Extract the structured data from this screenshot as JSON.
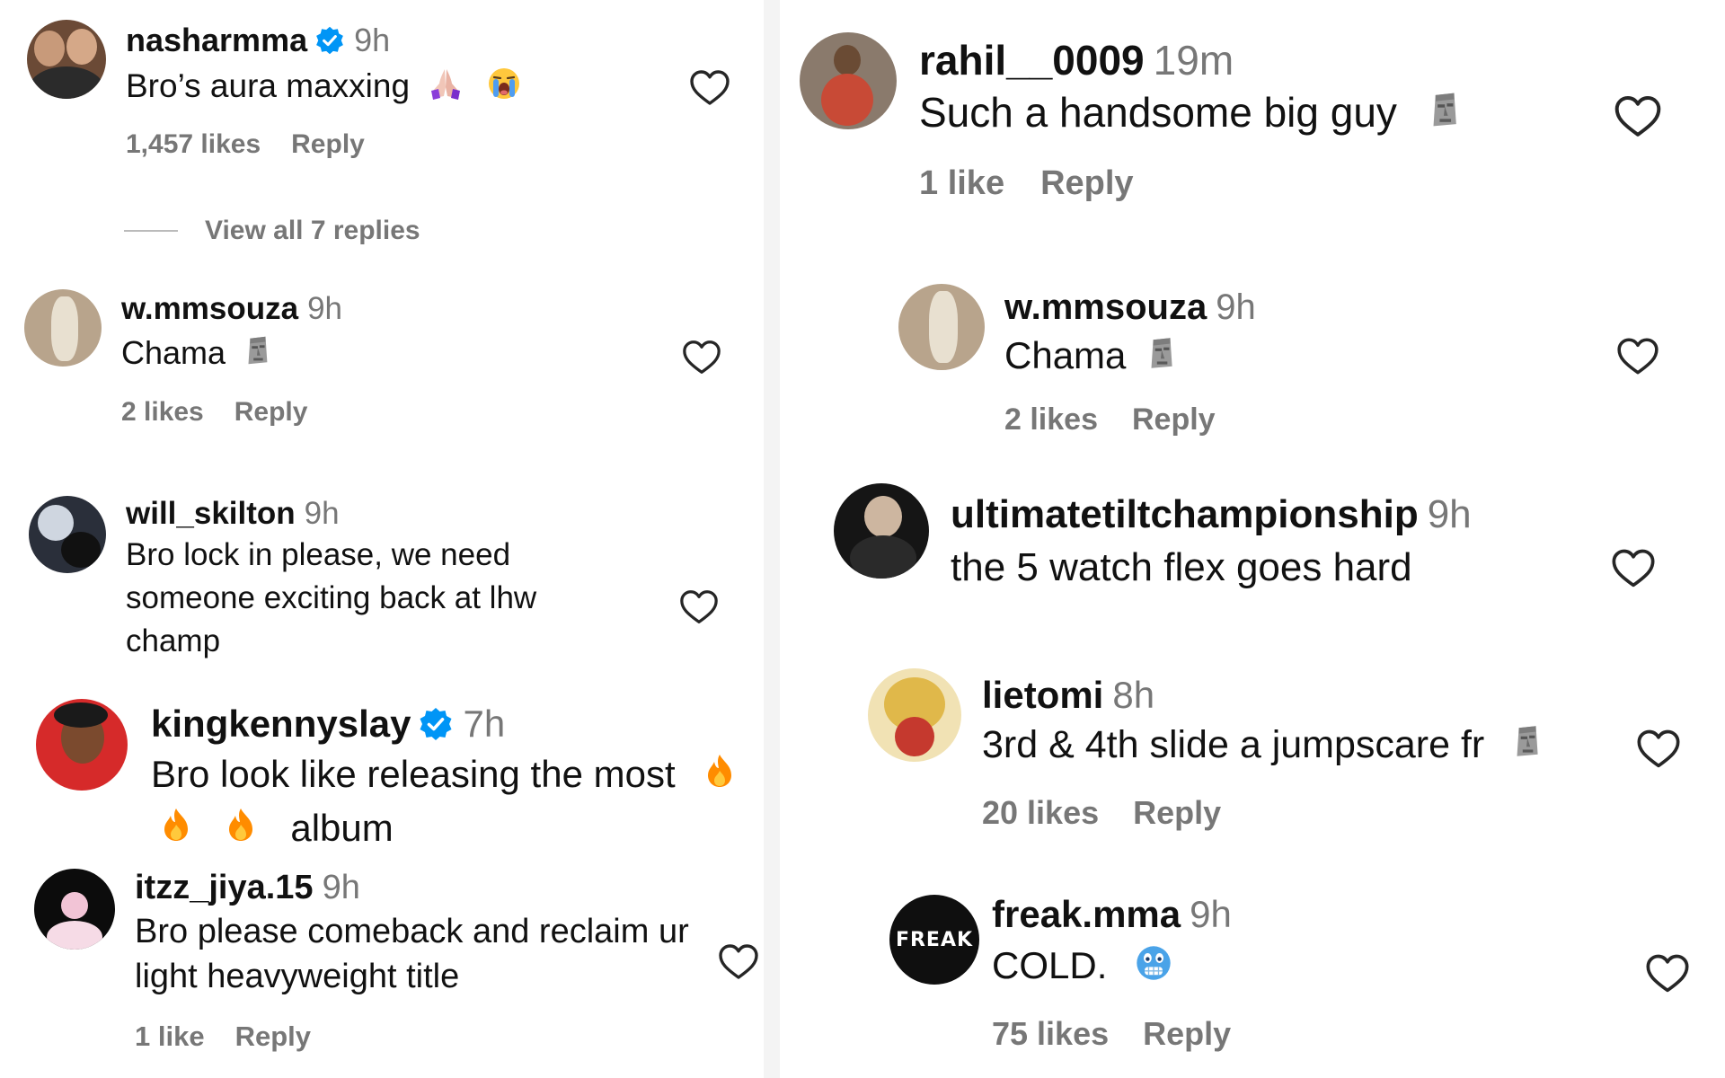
{
  "left_column": {
    "comments": [
      {
        "username": "nasharmma",
        "verified": true,
        "time": "9h",
        "text": "Bro’s aura maxxing",
        "emojis": [
          "praying-hands-icon",
          "crying-face-icon"
        ],
        "likes": "1,457 likes",
        "reply": "Reply",
        "view_replies": "View all 7 replies"
      },
      {
        "username": "w.mmsouza",
        "verified": false,
        "time": "9h",
        "text": "Chama",
        "emojis": [
          "moai-icon"
        ],
        "likes": "2 likes",
        "reply": "Reply"
      },
      {
        "username": "will_skilton",
        "verified": false,
        "time": "9h",
        "text_lines": [
          "Bro lock in please, we need",
          "someone exciting back at lhw",
          "champ"
        ]
      },
      {
        "username": "kingkennyslay",
        "verified": true,
        "time": "7h",
        "text_line1": "Bro look like releasing the most",
        "text_line2": "album",
        "emojis": [
          "fire-icon",
          "fire-icon",
          "fire-icon"
        ]
      },
      {
        "username": "itzz_jiya.15",
        "verified": false,
        "time": "9h",
        "text_lines": [
          "Bro please comeback and reclaim ur",
          "light heavyweight title"
        ],
        "likes": "1 like",
        "reply": "Reply"
      }
    ]
  },
  "right_column": {
    "comments": [
      {
        "username": "rahil__0009",
        "verified": false,
        "time": "19m",
        "text": "Such a handsome big guy",
        "emojis": [
          "moai-icon"
        ],
        "likes": "1 like",
        "reply": "Reply"
      },
      {
        "username": "w.mmsouza",
        "verified": false,
        "time": "9h",
        "text": "Chama",
        "emojis": [
          "moai-icon"
        ],
        "likes": "2 likes",
        "reply": "Reply"
      },
      {
        "username": "ultimatetiltchampionship",
        "verified": false,
        "time": "9h",
        "text": "the 5 watch flex goes hard"
      },
      {
        "username": "lietomi",
        "verified": false,
        "time": "8h",
        "text": "3rd & 4th slide a jumpscare fr",
        "emojis": [
          "moai-icon"
        ],
        "likes": "20 likes",
        "reply": "Reply"
      },
      {
        "username": "freak.mma",
        "verified": false,
        "time": "9h",
        "text": "COLD.",
        "emojis": [
          "cold-face-icon"
        ],
        "likes": "75 likes",
        "reply": "Reply",
        "avatar_text": "FREAK"
      }
    ]
  },
  "colors": {
    "verified_blue": "#0095f6",
    "meta_gray": "#777777",
    "heart_stroke": "#262626",
    "fire_orange": "#ff8c00",
    "cold_blue": "#4aa3e8"
  }
}
